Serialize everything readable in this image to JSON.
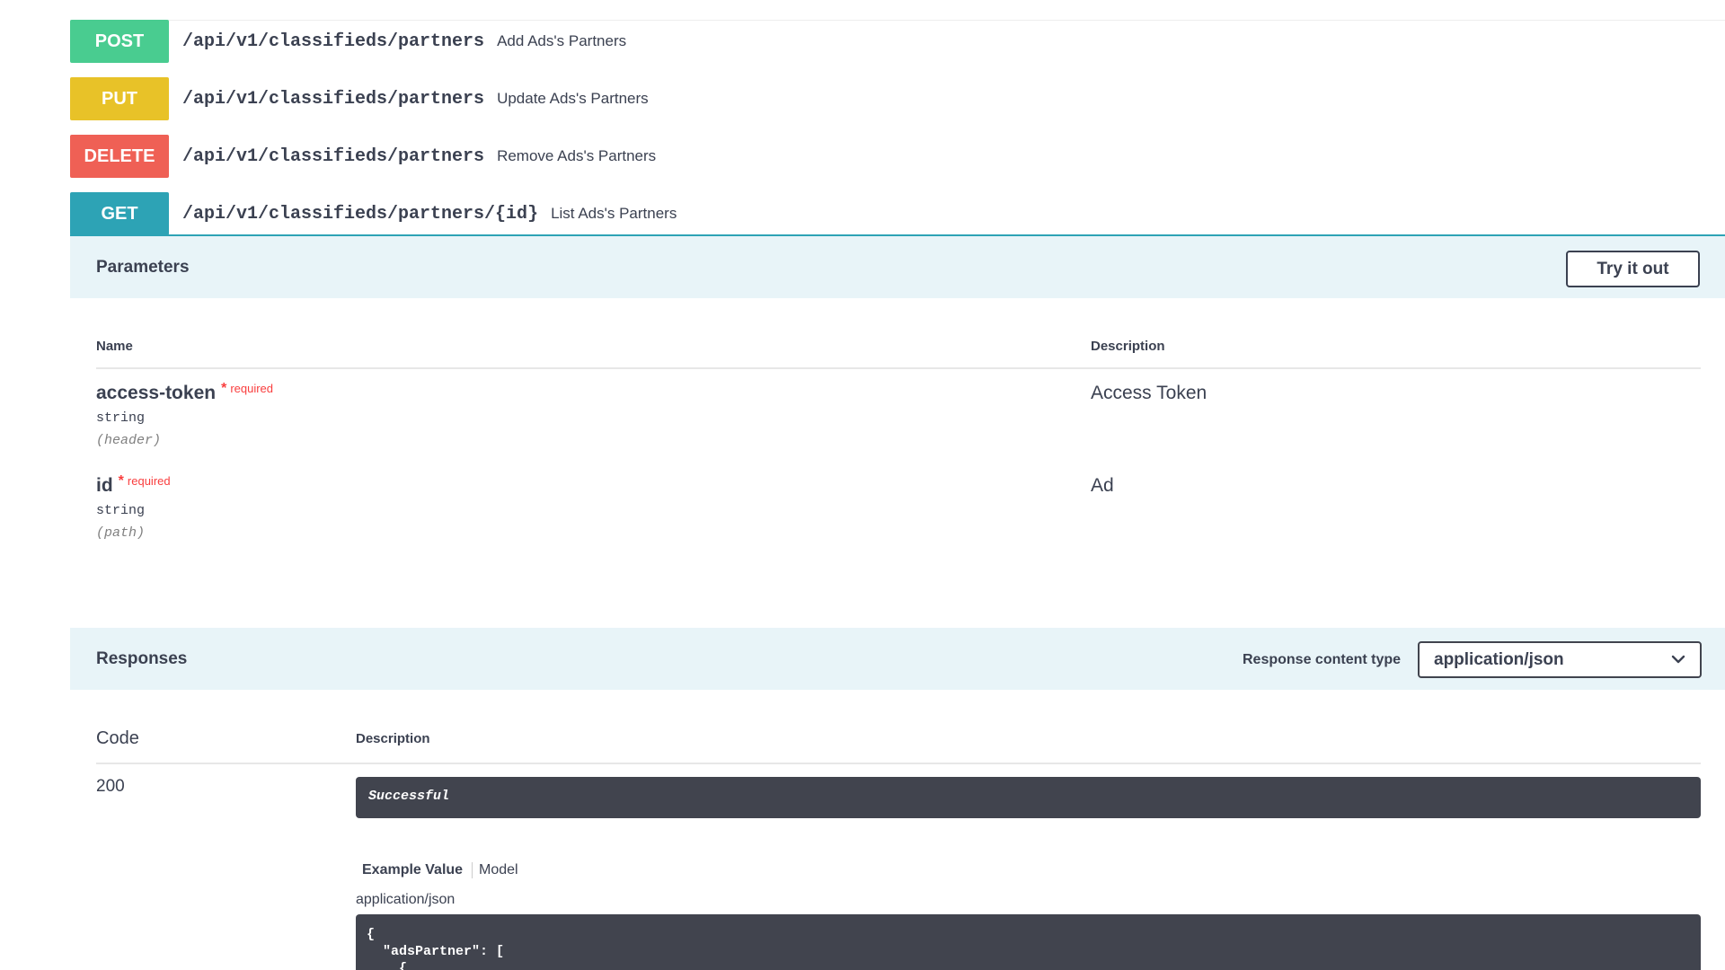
{
  "operations": [
    {
      "method": "POST",
      "path": "/api/v1/classifieds/partners",
      "summary": "Add Ads's Partners",
      "color": "#49cc90"
    },
    {
      "method": "PUT",
      "path": "/api/v1/classifieds/partners",
      "summary": "Update Ads's Partners",
      "color": "#fca130"
    },
    {
      "method": "DELETE",
      "path": "/api/v1/classifieds/partners",
      "summary": "Remove Ads's Partners",
      "color": "#f93e3e"
    },
    {
      "method": "GET",
      "path": "/api/v1/classifieds/partners/{id}",
      "summary": "List Ads's Partners",
      "color": "#61affe"
    }
  ],
  "parameters": {
    "title": "Parameters",
    "try_label": "Try it out",
    "col_name": "Name",
    "col_description": "Description",
    "items": [
      {
        "name": "access-token",
        "star": "*",
        "required": "required",
        "type": "string",
        "in": "(header)",
        "description": "Access Token"
      },
      {
        "name": "id",
        "star": "*",
        "required": "required",
        "type": "string",
        "in": "(path)",
        "description": "Ad"
      }
    ]
  },
  "responses": {
    "title": "Responses",
    "content_type_label": "Response content type",
    "content_type_value": "application/json",
    "col_code": "Code",
    "col_description": "Description",
    "items": [
      {
        "code": "200",
        "description": "Successful"
      }
    ],
    "tab_example": "Example Value",
    "tab_model": "Model",
    "media_type": "application/json",
    "code_lines": [
      "{",
      "  \"adsPartner\": [",
      "    {"
    ]
  }
}
